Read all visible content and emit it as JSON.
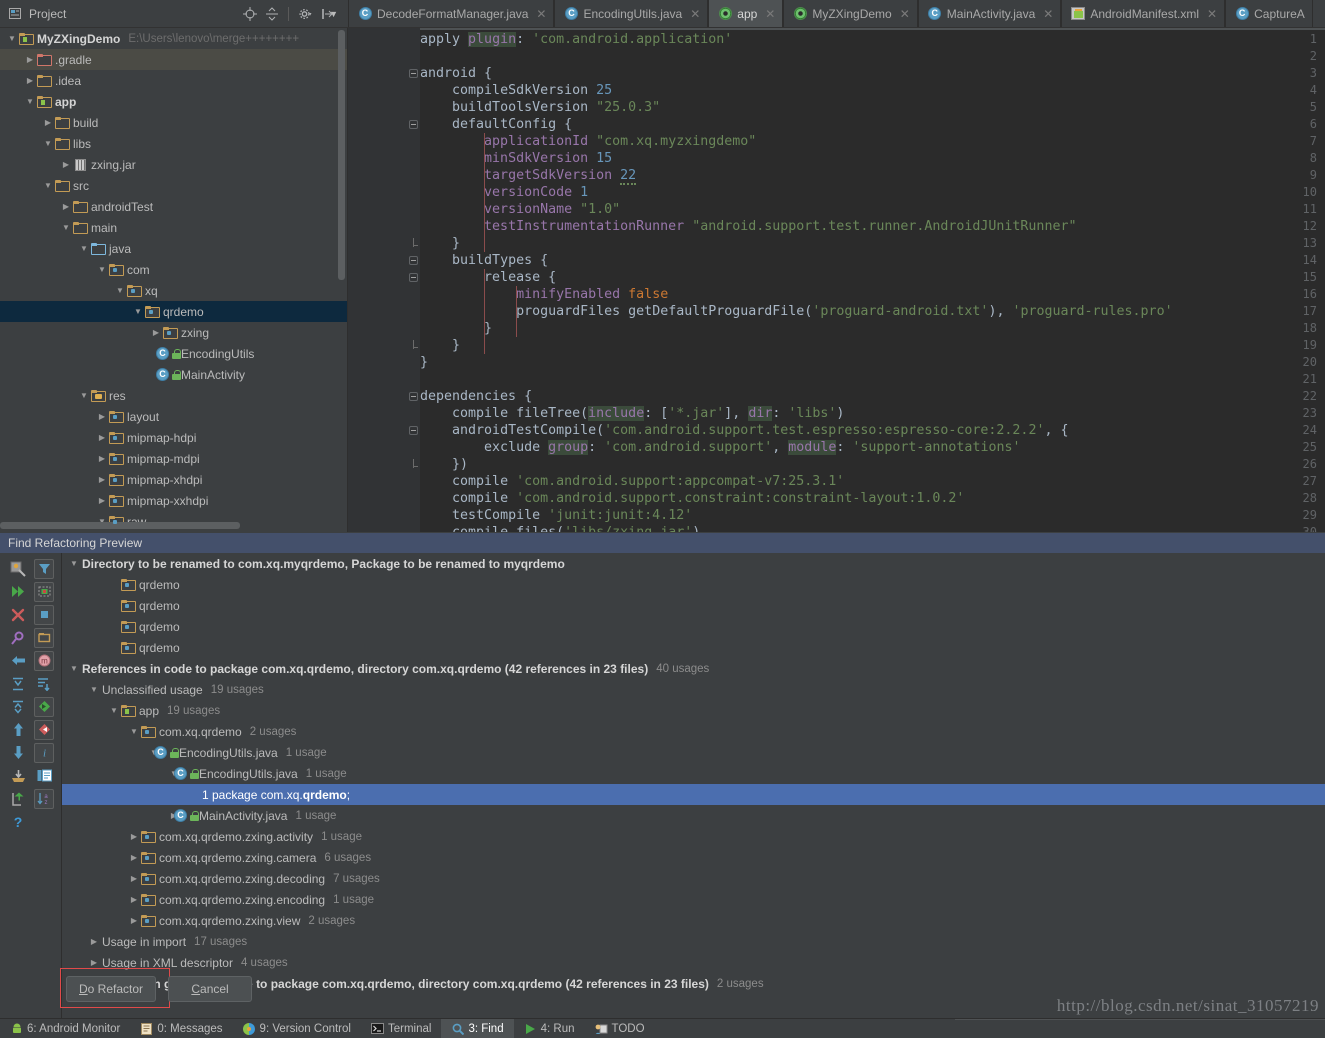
{
  "project_panel": {
    "title": "Project",
    "icon": "project-view-icon",
    "dropdown_icon": "chevron-down-icon",
    "toolbar": [
      {
        "name": "locate-icon",
        "glyph": "⊕"
      },
      {
        "name": "collapse-all-icon",
        "glyph": "≒"
      },
      {
        "name": "settings-gear-icon",
        "glyph": "⚙"
      },
      {
        "name": "hide-panel-icon",
        "glyph": "⇥"
      }
    ]
  },
  "tree": {
    "rows": [
      {
        "depth": 0,
        "arrow": "down",
        "icon": "folder-module",
        "label": "MyZXingDemo",
        "bold": true,
        "path": "E:\\Users\\lenovo\\merge++++++++"
      },
      {
        "depth": 1,
        "arrow": "right",
        "icon": "folder-red",
        "label": ".gradle",
        "highlight": true
      },
      {
        "depth": 1,
        "arrow": "right",
        "icon": "folder",
        "label": ".idea"
      },
      {
        "depth": 1,
        "arrow": "down",
        "icon": "folder-module",
        "label": "app",
        "bold": true
      },
      {
        "depth": 2,
        "arrow": "right",
        "icon": "folder",
        "label": "build"
      },
      {
        "depth": 2,
        "arrow": "down",
        "icon": "folder",
        "label": "libs"
      },
      {
        "depth": 3,
        "arrow": "right",
        "icon": "jar",
        "label": "zxing.jar"
      },
      {
        "depth": 2,
        "arrow": "down",
        "icon": "folder",
        "label": "src"
      },
      {
        "depth": 3,
        "arrow": "right",
        "icon": "folder",
        "label": "androidTest"
      },
      {
        "depth": 3,
        "arrow": "down",
        "icon": "folder",
        "label": "main"
      },
      {
        "depth": 4,
        "arrow": "down",
        "icon": "folder-blue",
        "label": "java"
      },
      {
        "depth": 5,
        "arrow": "down",
        "icon": "folder-package",
        "label": "com"
      },
      {
        "depth": 6,
        "arrow": "down",
        "icon": "folder-package",
        "label": "xq"
      },
      {
        "depth": 7,
        "arrow": "down",
        "icon": "folder-package",
        "label": "qrdemo",
        "selected": true
      },
      {
        "depth": 8,
        "arrow": "right",
        "icon": "folder-package",
        "label": "zxing"
      },
      {
        "depth": 8,
        "arrow": "none",
        "icon": "java-class",
        "label": "EncodingUtils"
      },
      {
        "depth": 8,
        "arrow": "none",
        "icon": "java-class",
        "label": "MainActivity"
      },
      {
        "depth": 4,
        "arrow": "down",
        "icon": "folder-res",
        "label": "res"
      },
      {
        "depth": 5,
        "arrow": "right",
        "icon": "folder-package",
        "label": "layout"
      },
      {
        "depth": 5,
        "arrow": "right",
        "icon": "folder-package",
        "label": "mipmap-hdpi"
      },
      {
        "depth": 5,
        "arrow": "right",
        "icon": "folder-package",
        "label": "mipmap-mdpi"
      },
      {
        "depth": 5,
        "arrow": "right",
        "icon": "folder-package",
        "label": "mipmap-xhdpi"
      },
      {
        "depth": 5,
        "arrow": "right",
        "icon": "folder-package",
        "label": "mipmap-xxhdpi"
      },
      {
        "depth": 5,
        "arrow": "down",
        "icon": "folder-package",
        "label": "raw"
      }
    ]
  },
  "editor_tabs": [
    {
      "label": "DecodeFormatManager.java",
      "icon": "java-class-icon",
      "active": false,
      "closable": true
    },
    {
      "label": "EncodingUtils.java",
      "icon": "java-class-icon",
      "active": false,
      "closable": true
    },
    {
      "label": "app",
      "icon": "gradle-icon",
      "active": true,
      "closable": true
    },
    {
      "label": "MyZXingDemo",
      "icon": "gradle-icon",
      "active": false,
      "closable": true
    },
    {
      "label": "MainActivity.java",
      "icon": "java-class-icon",
      "active": false,
      "closable": true
    },
    {
      "label": "AndroidManifest.xml",
      "icon": "android-xml-icon",
      "active": false,
      "closable": true
    },
    {
      "label": "CaptureA",
      "icon": "java-class-icon",
      "active": false,
      "closable": false
    }
  ],
  "editor": {
    "filename": "app",
    "first_line": 1,
    "last_visible_line": 30,
    "lines": [
      {
        "n": 1,
        "text": "apply plugin: 'com.android.application'"
      },
      {
        "n": 2,
        "text": ""
      },
      {
        "n": 3,
        "text": "android {"
      },
      {
        "n": 4,
        "text": "    compileSdkVersion 25"
      },
      {
        "n": 5,
        "text": "    buildToolsVersion \"25.0.3\""
      },
      {
        "n": 6,
        "text": "    defaultConfig {"
      },
      {
        "n": 7,
        "text": "        applicationId \"com.xq.myzxingdemo\""
      },
      {
        "n": 8,
        "text": "        minSdkVersion 15"
      },
      {
        "n": 9,
        "text": "        targetSdkVersion 22"
      },
      {
        "n": 10,
        "text": "        versionCode 1"
      },
      {
        "n": 11,
        "text": "        versionName \"1.0\""
      },
      {
        "n": 12,
        "text": "        testInstrumentationRunner \"android.support.test.runner.AndroidJUnitRunner\""
      },
      {
        "n": 13,
        "text": "    }"
      },
      {
        "n": 14,
        "text": "    buildTypes {"
      },
      {
        "n": 15,
        "text": "        release {"
      },
      {
        "n": 16,
        "text": "            minifyEnabled false"
      },
      {
        "n": 17,
        "text": "            proguardFiles getDefaultProguardFile('proguard-android.txt'), 'proguard-rules.pro'"
      },
      {
        "n": 18,
        "text": "        }"
      },
      {
        "n": 19,
        "text": "    }"
      },
      {
        "n": 20,
        "text": "}"
      },
      {
        "n": 21,
        "text": ""
      },
      {
        "n": 22,
        "text": "dependencies {"
      },
      {
        "n": 23,
        "text": "    compile fileTree(include: ['*.jar'], dir: 'libs')"
      },
      {
        "n": 24,
        "text": "    androidTestCompile('com.android.support.test.espresso:espresso-core:2.2.2', {"
      },
      {
        "n": 25,
        "text": "        exclude group: 'com.android.support', module: 'support-annotations'"
      },
      {
        "n": 26,
        "text": "    })"
      },
      {
        "n": 27,
        "text": "    compile 'com.android.support:appcompat-v7:25.3.1'"
      },
      {
        "n": 28,
        "text": "    compile 'com.android.support.constraint:constraint-layout:1.0.2'"
      },
      {
        "n": 29,
        "text": "    testCompile 'junit:junit:4.12'"
      },
      {
        "n": 30,
        "text": "    compile files('libs/zxing.jar')"
      }
    ]
  },
  "find_panel": {
    "title": "Find Refactoring Preview",
    "toolbar": [
      {
        "name": "rerun-refactoring-icon",
        "glyph": "⚒"
      },
      {
        "name": "filter-icon",
        "glyph": "▼"
      },
      {
        "name": "run-next-icon",
        "glyph": "▶▶"
      },
      {
        "name": "preview-usages-icon",
        "glyph": "▣"
      },
      {
        "name": "close-icon",
        "glyph": "✕"
      },
      {
        "name": "stop-icon",
        "glyph": "■"
      },
      {
        "name": "pin-tab-icon",
        "glyph": "●"
      },
      {
        "name": "group-by-directory-icon",
        "glyph": "▭"
      },
      {
        "name": "back-icon",
        "glyph": "⇦"
      },
      {
        "name": "group-by-module-icon",
        "glyph": "m"
      },
      {
        "name": "expand-all-icon",
        "glyph": "⤓"
      },
      {
        "name": "sort-members-icon",
        "glyph": "⇩"
      },
      {
        "name": "collapse-all-icon",
        "glyph": "⤒"
      },
      {
        "name": "previous-occurrence-icon",
        "glyph": "◀"
      },
      {
        "name": "up-arrow-icon",
        "glyph": "↑"
      },
      {
        "name": "next-occurrence-icon",
        "glyph": "▶"
      },
      {
        "name": "down-arrow-icon",
        "glyph": "↓"
      },
      {
        "name": "info-icon",
        "glyph": "i"
      },
      {
        "name": "export-to-file-icon",
        "glyph": "⤓"
      },
      {
        "name": "show-read-write-icon",
        "glyph": "▤"
      },
      {
        "name": "open-in-new-tab-icon",
        "glyph": "↱"
      },
      {
        "name": "sort-alphabetically-icon",
        "glyph": "a↓z"
      },
      {
        "name": "help-icon",
        "glyph": "?"
      }
    ],
    "rows": [
      {
        "depth": 0,
        "arrow": "down",
        "bold": true,
        "label": "Directory to be renamed to com.xq.myqrdemo, Package to be renamed to myqrdemo"
      },
      {
        "depth": 2,
        "arrow": "none",
        "icon": "folder-package",
        "label": "qrdemo"
      },
      {
        "depth": 2,
        "arrow": "none",
        "icon": "folder-package",
        "label": "qrdemo"
      },
      {
        "depth": 2,
        "arrow": "none",
        "icon": "folder-package",
        "label": "qrdemo"
      },
      {
        "depth": 2,
        "arrow": "none",
        "icon": "folder-package",
        "label": "qrdemo"
      },
      {
        "depth": 0,
        "arrow": "down",
        "bold": true,
        "label": "References in code to package com.xq.qrdemo, directory com.xq.qrdemo (42 references in 23 files)",
        "usages": "40 usages"
      },
      {
        "depth": 1,
        "arrow": "down",
        "label": "Unclassified usage",
        "usages": "19 usages"
      },
      {
        "depth": 2,
        "arrow": "down",
        "icon": "folder-module",
        "label": "app",
        "usages": "19 usages"
      },
      {
        "depth": 3,
        "arrow": "down",
        "icon": "folder-package",
        "label": "com.xq.qrdemo",
        "usages": "2 usages"
      },
      {
        "depth": 4,
        "arrow": "down",
        "icon": "java-class",
        "label": "EncodingUtils.java",
        "usages": "1 usage"
      },
      {
        "depth": 5,
        "arrow": "down",
        "icon": "java-class",
        "label": "EncodingUtils.java",
        "usages": "1 usage"
      },
      {
        "depth": 6,
        "arrow": "none",
        "label": "1 package com.xq.qrdemo;",
        "selected": true,
        "code": true
      },
      {
        "depth": 5,
        "arrow": "right",
        "icon": "java-class",
        "label": "MainActivity.java",
        "usages": "1 usage"
      },
      {
        "depth": 3,
        "arrow": "right",
        "icon": "folder-package",
        "label": "com.xq.qrdemo.zxing.activity",
        "usages": "1 usage"
      },
      {
        "depth": 3,
        "arrow": "right",
        "icon": "folder-package",
        "label": "com.xq.qrdemo.zxing.camera",
        "usages": "6 usages"
      },
      {
        "depth": 3,
        "arrow": "right",
        "icon": "folder-package",
        "label": "com.xq.qrdemo.zxing.decoding",
        "usages": "7 usages"
      },
      {
        "depth": 3,
        "arrow": "right",
        "icon": "folder-package",
        "label": "com.xq.qrdemo.zxing.encoding",
        "usages": "1 usage"
      },
      {
        "depth": 3,
        "arrow": "right",
        "icon": "folder-package",
        "label": "com.xq.qrdemo.zxing.view",
        "usages": "2 usages"
      },
      {
        "depth": 1,
        "arrow": "right",
        "label": "Usage in import",
        "usages": "17 usages"
      },
      {
        "depth": 1,
        "arrow": "right",
        "label": "Usage in XML descriptor",
        "usages": "4 usages"
      },
      {
        "depth": 0,
        "arrow": "right",
        "bold": true,
        "label": "References in generated code to package com.xq.qrdemo, directory com.xq.qrdemo (42 references in 23 files)",
        "usages": "2 usages"
      }
    ],
    "buttons": [
      {
        "name": "do-refactor-button",
        "label": "Do Refactor",
        "mnemonic": "D",
        "highlighted": true
      },
      {
        "name": "cancel-button",
        "label": "Cancel",
        "mnemonic": "C",
        "highlighted": false
      }
    ]
  },
  "statusbar": {
    "items": [
      {
        "label": "6: Android Monitor",
        "icon": "android-icon",
        "active": false
      },
      {
        "label": "0: Messages",
        "icon": "messages-icon",
        "active": false
      },
      {
        "label": "9: Version Control",
        "icon": "version-control-icon",
        "active": false
      },
      {
        "label": "Terminal",
        "icon": "terminal-icon",
        "active": false
      },
      {
        "label": "3: Find",
        "icon": "search-icon",
        "active": true
      },
      {
        "label": "4: Run",
        "icon": "run-icon",
        "active": false
      },
      {
        "label": "TODO",
        "icon": "todo-icon",
        "active": false
      }
    ]
  },
  "watermark": {
    "text": "http://blog.csdn.net/sinat_31057219"
  },
  "colors": {
    "panel_bg": "#3c3f41",
    "editor_bg": "#2b2b2b",
    "gutter_bg": "#313335",
    "tree_selection": "#0d293e",
    "find_selection": "#4b6eaf",
    "find_title_bg": "#44506b",
    "accent_highlight": "#e04a4a",
    "keyword": "#cc7832",
    "string": "#6a8759",
    "number": "#6897bb",
    "property": "#9876aa"
  }
}
